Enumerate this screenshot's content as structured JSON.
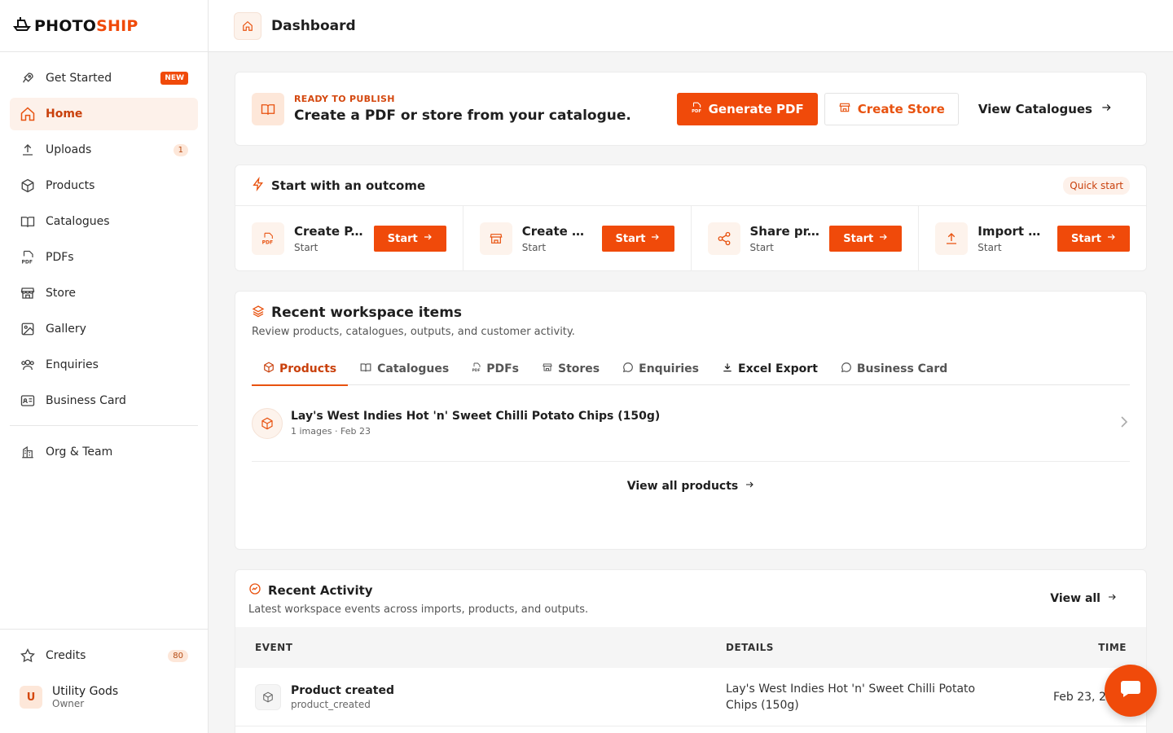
{
  "app": {
    "logo_part1": "PHOTO",
    "logo_part2": "SHIP",
    "brand_color": "#f04a0a"
  },
  "sidebar": {
    "items": [
      {
        "label": "Get Started",
        "badge": "NEW",
        "icon": "rocket-icon"
      },
      {
        "label": "Home",
        "icon": "home-icon",
        "active": true
      },
      {
        "label": "Uploads",
        "badge": "1",
        "icon": "upload-icon"
      },
      {
        "label": "Products",
        "icon": "box-icon"
      },
      {
        "label": "Catalogues",
        "icon": "book-open-icon"
      },
      {
        "label": "PDFs",
        "icon": "pdf-file-icon"
      },
      {
        "label": "Store",
        "icon": "store-icon"
      },
      {
        "label": "Gallery",
        "icon": "image-icon"
      },
      {
        "label": "Enquiries",
        "icon": "users-icon"
      },
      {
        "label": "Business Card",
        "icon": "id-card-icon"
      }
    ],
    "org_item": {
      "label": "Org & Team",
      "icon": "building-icon"
    },
    "credits": {
      "label": "Credits",
      "value": "80",
      "icon": "star-icon"
    },
    "user": {
      "initial": "U",
      "name": "Utility Gods",
      "role": "Owner"
    }
  },
  "header": {
    "title": "Dashboard"
  },
  "publish": {
    "eyebrow": "READY TO PUBLISH",
    "title": "Create a PDF or store from your catalogue.",
    "generate_pdf": "Generate PDF",
    "create_store": "Create Store",
    "view_catalogues": "View Catalogues"
  },
  "outcome": {
    "title": "Start with an outcome",
    "quick_start": "Quick start",
    "cards": [
      {
        "name": "Create P...",
        "sub": "Start",
        "button": "Start",
        "icon": "pdf-file-icon"
      },
      {
        "name": "Create S...",
        "sub": "Start",
        "button": "Start",
        "icon": "store-icon"
      },
      {
        "name": "Share pr...",
        "sub": "Start",
        "button": "Start",
        "icon": "share-icon"
      },
      {
        "name": "Import d...",
        "sub": "Start",
        "button": "Start",
        "icon": "upload-icon"
      }
    ]
  },
  "workspace": {
    "title": "Recent workspace items",
    "subtitle": "Review products, catalogues, outputs, and customer activity.",
    "tabs": [
      {
        "label": "Products",
        "active": true,
        "icon": "box-icon"
      },
      {
        "label": "Catalogues",
        "icon": "book-open-icon"
      },
      {
        "label": "PDFs",
        "icon": "pdf-file-icon"
      },
      {
        "label": "Stores",
        "icon": "store-icon"
      },
      {
        "label": "Enquiries",
        "icon": "chat-icon"
      },
      {
        "label": "Excel Export",
        "icon": "download-icon"
      },
      {
        "label": "Business Card",
        "icon": "chat-icon"
      }
    ],
    "item": {
      "title": "Lay's West Indies Hot 'n' Sweet Chilli Potato Chips (150g)",
      "meta": "1 images · Feb 23"
    },
    "view_all": "View all products"
  },
  "activity": {
    "title": "Recent Activity",
    "subtitle": "Latest workspace events across imports, products, and outputs.",
    "view_all": "View all",
    "columns": {
      "event": "EVENT",
      "details": "DETAILS",
      "time": "TIME"
    },
    "rows": [
      {
        "event": "Product created",
        "code": "product_created",
        "details": "Lay's West Indies Hot 'n' Sweet Chilli Potato Chips (150g)",
        "time": "Feb 23, 2"
      }
    ]
  }
}
